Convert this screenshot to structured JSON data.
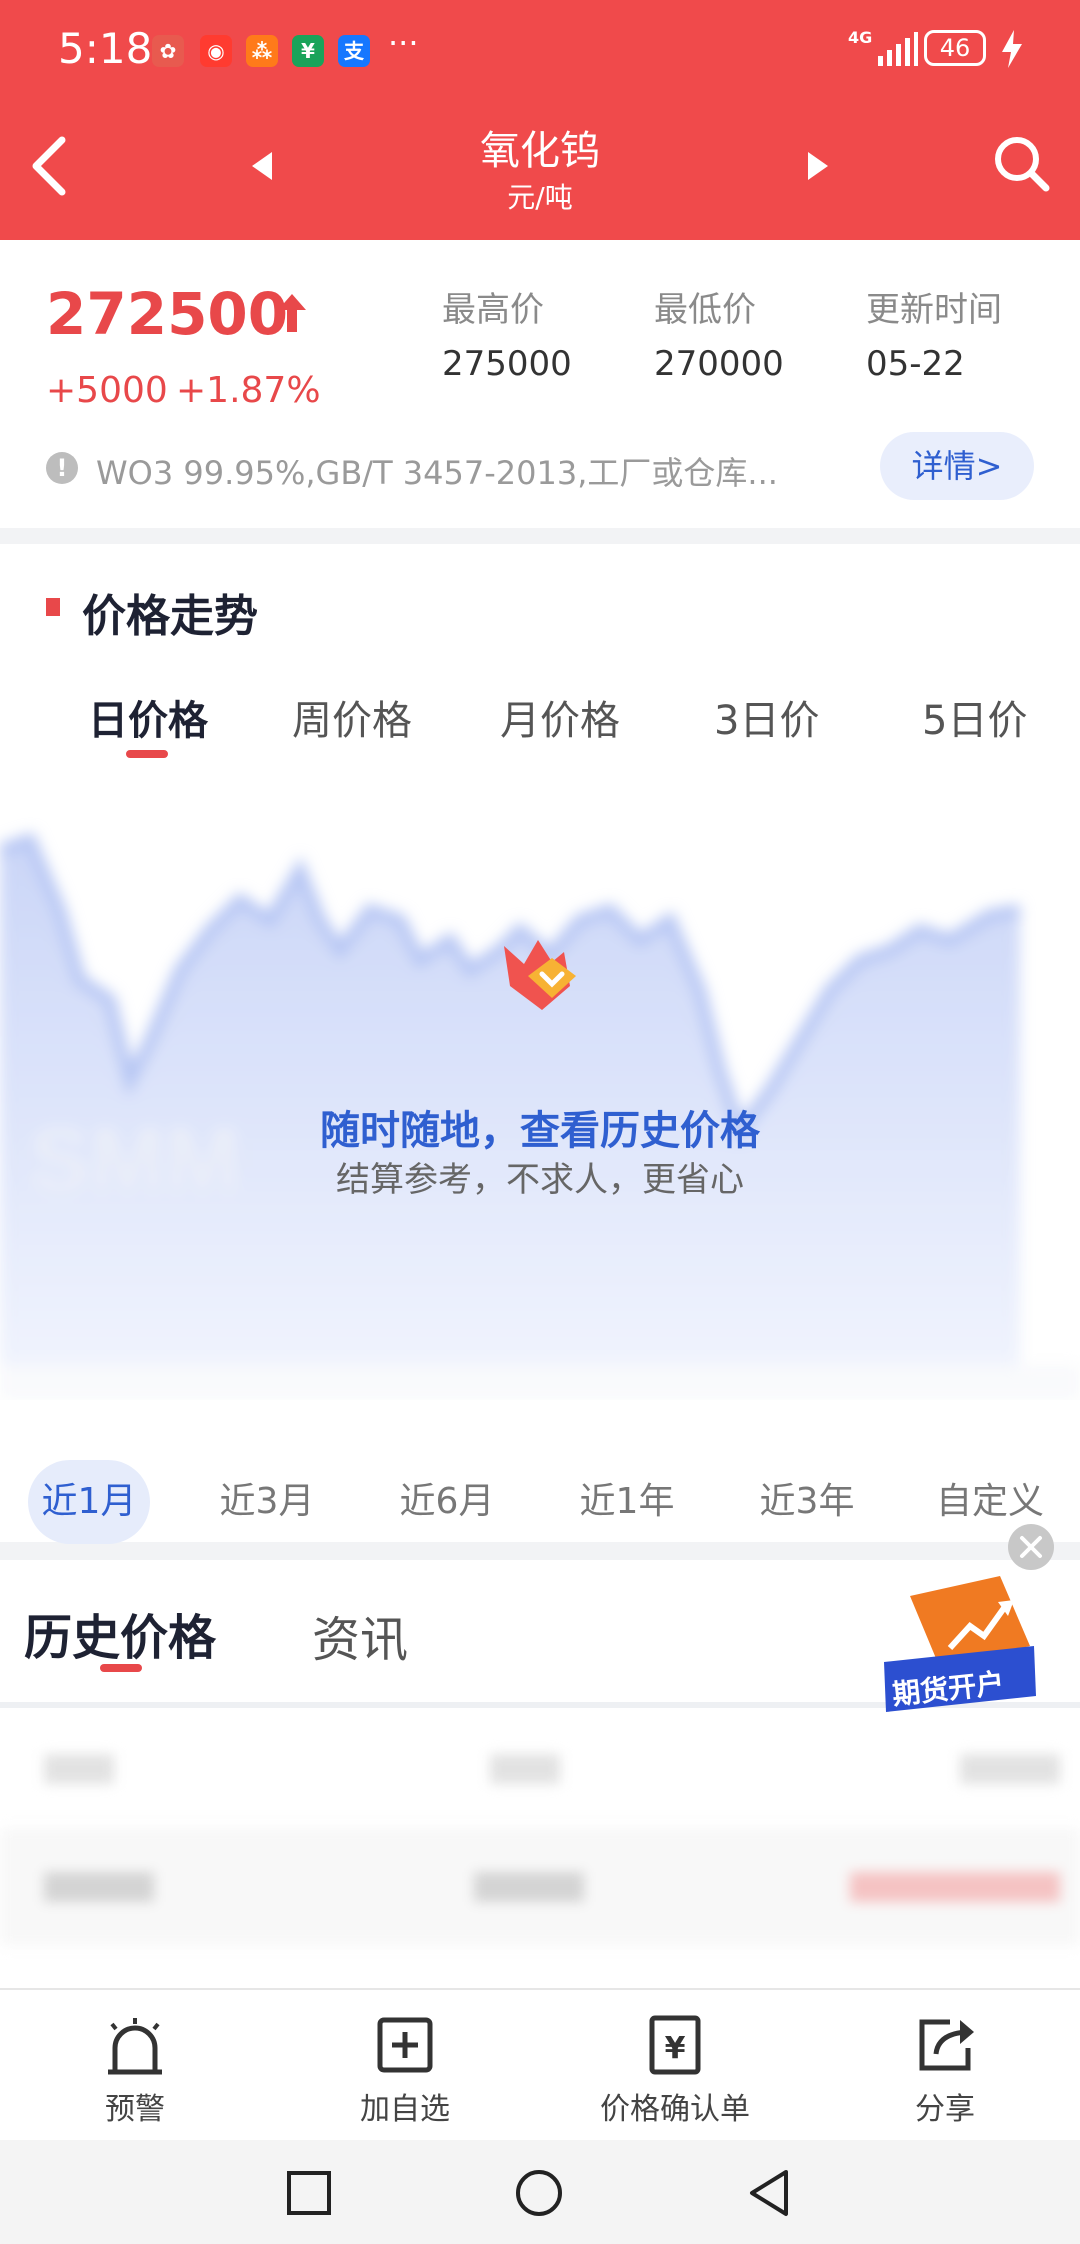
{
  "status_bar": {
    "time": "5:18",
    "more": "···",
    "network": "4G",
    "battery": "46"
  },
  "header": {
    "title": "氧化钨",
    "subtitle": "元/吨",
    "back_icon": "back-chevron-icon",
    "prev_icon": "triangle-left-icon",
    "next_icon": "triangle-right-icon",
    "search_icon": "search-icon",
    "bg_color": "#f04a4b"
  },
  "price": {
    "current": "272500",
    "change_abs": "+5000",
    "change_pct": "+1.87%",
    "high_label": "最高价",
    "high_value": "275000",
    "low_label": "最低价",
    "low_value": "270000",
    "update_label": "更新时间",
    "update_value": "05-22",
    "spec": "WO3 99.95%,GB/T 3457-2013,工厂或仓库...",
    "detail_button": "详情>",
    "up_color": "#e8484a"
  },
  "trend": {
    "title": "价格走势",
    "period_tabs": [
      "日价格",
      "周价格",
      "月价格",
      "3日价",
      "5日价"
    ],
    "active_period": 0,
    "promo_title": "随时随地，查看历史价格",
    "promo_sub": "结算参考，不求人，更省心",
    "range_tabs": [
      "近1月",
      "近3月",
      "近6月",
      "近1年",
      "近3年",
      "自定义"
    ],
    "active_range": 0
  },
  "history": {
    "tabs": [
      "历史价格",
      "资讯"
    ],
    "active_tab": 0,
    "badge_label": "期货开户"
  },
  "bottom_bar": {
    "items": [
      {
        "label": "预警",
        "icon": "alarm-bell-icon"
      },
      {
        "label": "加自选",
        "icon": "add-box-icon"
      },
      {
        "label": "价格确认单",
        "icon": "yuan-document-icon"
      },
      {
        "label": "分享",
        "icon": "share-icon"
      }
    ]
  }
}
